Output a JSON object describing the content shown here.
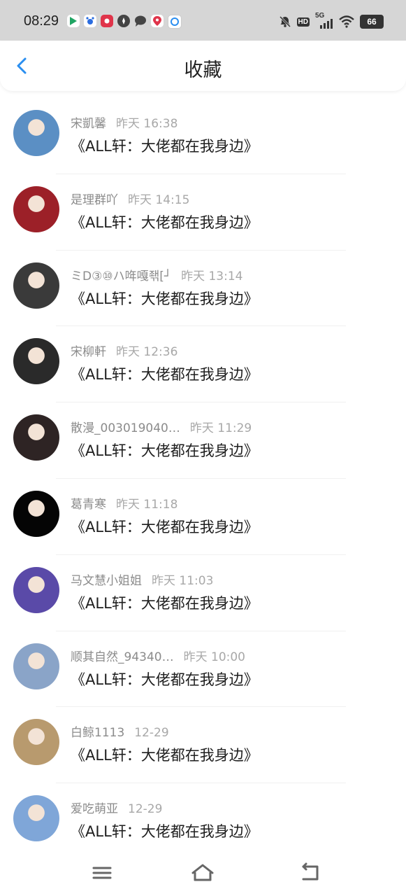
{
  "status_bar": {
    "time": "08:29",
    "battery": "66",
    "network": "5G",
    "hd": "HD"
  },
  "header": {
    "title": "收藏",
    "back_icon": "chevron-left-icon",
    "accent_color": "#2a8ef0"
  },
  "items": [
    {
      "user": "宋凱馨",
      "time": "昨天 16:38",
      "book": "《ALL轩：大佬都在我身边》",
      "avatar_color": "#5b8fc4"
    },
    {
      "user": "是理群吖",
      "time": "昨天 14:15",
      "book": "《ALL轩：大佬都在我身边》",
      "avatar_color": "#9c2028"
    },
    {
      "user": "ミD③⑩ハ哖嘎좪[┘",
      "time": "昨天 13:14",
      "book": "《ALL轩：大佬都在我身边》",
      "avatar_color": "#3a3a3a"
    },
    {
      "user": "宋柳軒",
      "time": "昨天 12:36",
      "book": "《ALL轩：大佬都在我身边》",
      "avatar_color": "#2a2a2a"
    },
    {
      "user": "散漫_003019040…",
      "time": "昨天 11:29",
      "book": "《ALL轩：大佬都在我身边》",
      "avatar_color": "#2e2424"
    },
    {
      "user": "葛青寒",
      "time": "昨天 11:18",
      "book": "《ALL轩：大佬都在我身边》",
      "avatar_color": "#050505"
    },
    {
      "user": "马文慧小姐姐",
      "time": "昨天 11:03",
      "book": "《ALL轩：大佬都在我身边》",
      "avatar_color": "#5a4aa8"
    },
    {
      "user": "顺其自然_94340…",
      "time": "昨天 10:00",
      "book": "《ALL轩：大佬都在我身边》",
      "avatar_color": "#8aa4c8"
    },
    {
      "user": "白鲸1113",
      "time": "12-29",
      "book": "《ALL轩：大佬都在我身边》",
      "avatar_color": "#b89a6e"
    },
    {
      "user": "爱吃萌亚",
      "time": "12-29",
      "book": "《ALL轩：大佬都在我身边》",
      "avatar_color": "#7fa6d8"
    }
  ],
  "nav": {
    "menu_icon": "menu-icon",
    "home_icon": "home-icon",
    "back_icon": "back-icon"
  }
}
